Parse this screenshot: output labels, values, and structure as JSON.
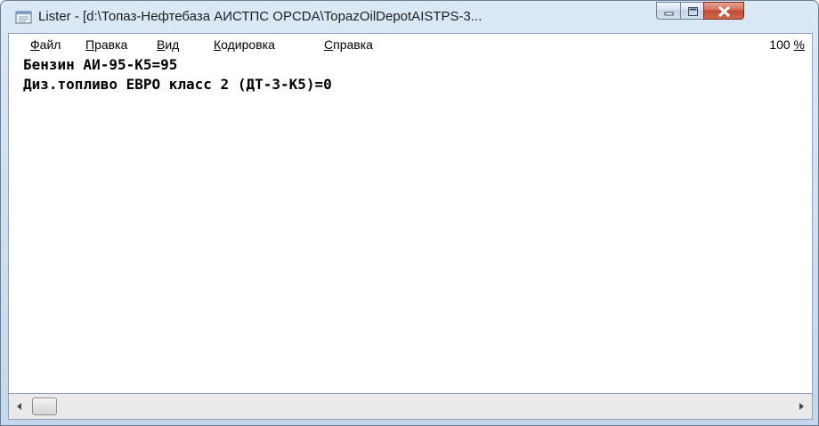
{
  "window": {
    "title": "Lister - [d:\\Топаз-Нефтебаза АИСТПС OPCDA\\TopazOilDepotAISTPS-3..."
  },
  "menu": {
    "items": [
      {
        "acc": "Ф",
        "rest": "айл"
      },
      {
        "acc": "П",
        "rest": "равка"
      },
      {
        "acc": "В",
        "rest": "ид"
      },
      {
        "acc": "К",
        "rest": "одировка"
      },
      {
        "acc": "С",
        "rest": "правка"
      }
    ],
    "zoom_value": "100 ",
    "zoom_acc": "%"
  },
  "content": {
    "lines": [
      "Бензин АИ-95-К5=95",
      "Диз.топливо ЕВРО класс 2 (ДТ-3-К5)=0"
    ]
  },
  "icons": {
    "app": "document-viewer-icon",
    "minimize": "minimize-icon",
    "maximize": "maximize-icon",
    "close": "close-icon",
    "scroll_left": "arrow-left-icon",
    "scroll_right": "arrow-right-icon"
  },
  "colors": {
    "frame": "#c5d7eb",
    "close_button": "#c24a32"
  }
}
